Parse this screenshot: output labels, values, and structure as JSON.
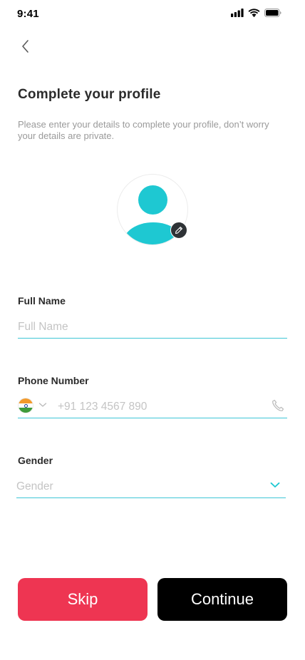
{
  "status_bar": {
    "time": "9:41"
  },
  "header": {
    "back_icon": "chevron-left-icon",
    "title": "Complete your profile",
    "subtitle": "Please enter your details to complete your profile, don’t worry your details are private."
  },
  "avatar": {
    "icon": "user-icon",
    "edit_icon": "pencil-icon"
  },
  "form": {
    "full_name": {
      "label": "Full Name",
      "placeholder": "Full Name",
      "value": ""
    },
    "phone": {
      "label": "Phone Number",
      "placeholder": "+91 123 4567 890",
      "value": "",
      "country_flag": "india-flag-icon",
      "icon": "phone-icon"
    },
    "gender": {
      "label": "Gender",
      "placeholder": "Gender",
      "selected": "",
      "icon": "chevron-down-icon"
    }
  },
  "actions": {
    "skip_label": "Skip",
    "continue_label": "Continue"
  },
  "colors": {
    "accent": "#1ec8d2",
    "field_underline": "#3ec6d6",
    "skip_button": "#ee3552",
    "continue_button": "#000000",
    "flag_saffron": "#f39a2b",
    "flag_white": "#ffffff",
    "flag_green": "#3f9b3a"
  }
}
